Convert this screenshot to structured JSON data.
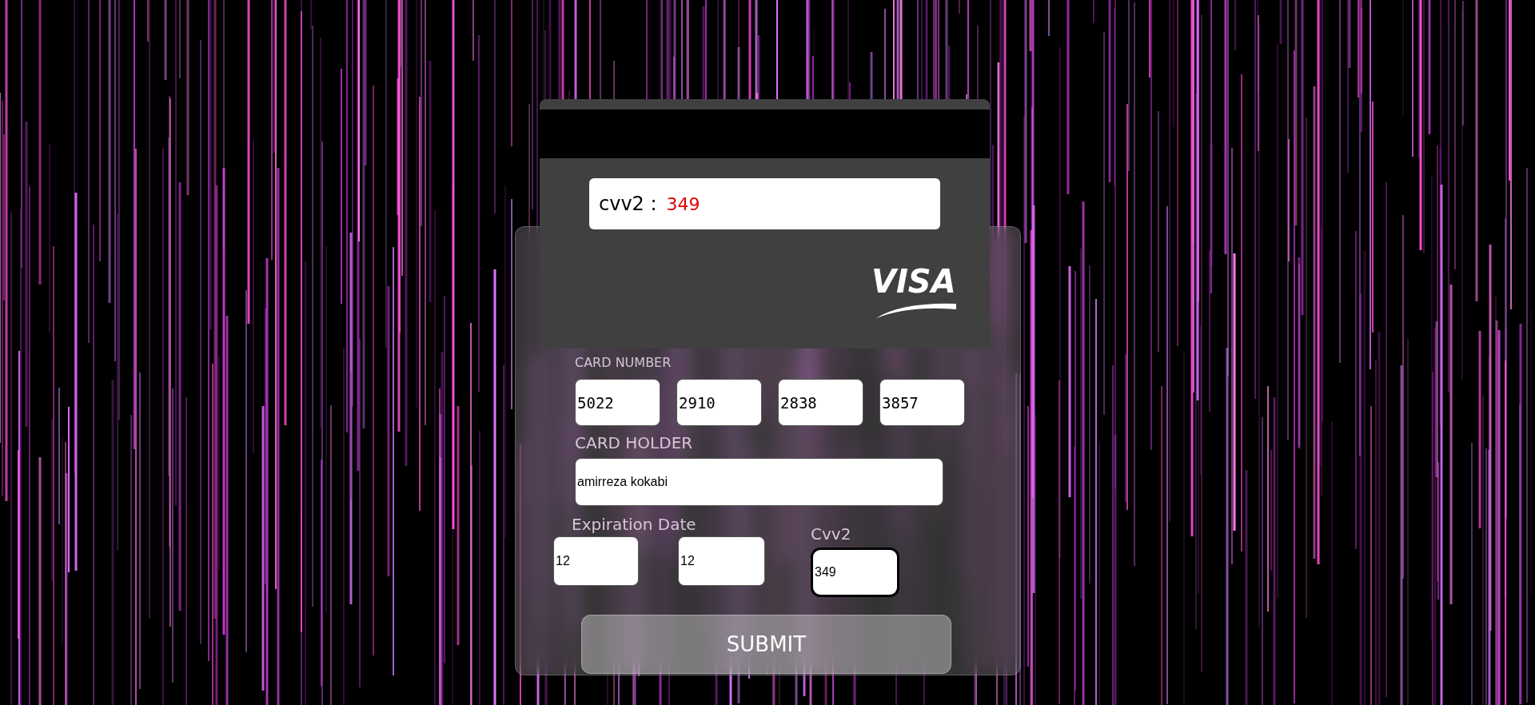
{
  "card_back": {
    "cvv_label": "cvv2 :",
    "cvv_value": "349",
    "brand": "VISA"
  },
  "form": {
    "card_number": {
      "label": "CARD NUMBER",
      "groups": [
        "5022",
        "2910",
        "2838",
        "3857"
      ]
    },
    "card_holder": {
      "label": "CARD HOLDER",
      "value": "amirreza kokabi"
    },
    "expiration": {
      "label": "Expiration Date",
      "month": "12",
      "year": "12"
    },
    "cvv2": {
      "label": "Cvv2",
      "value": "349",
      "focused": true
    },
    "submit": "SUBMIT"
  }
}
